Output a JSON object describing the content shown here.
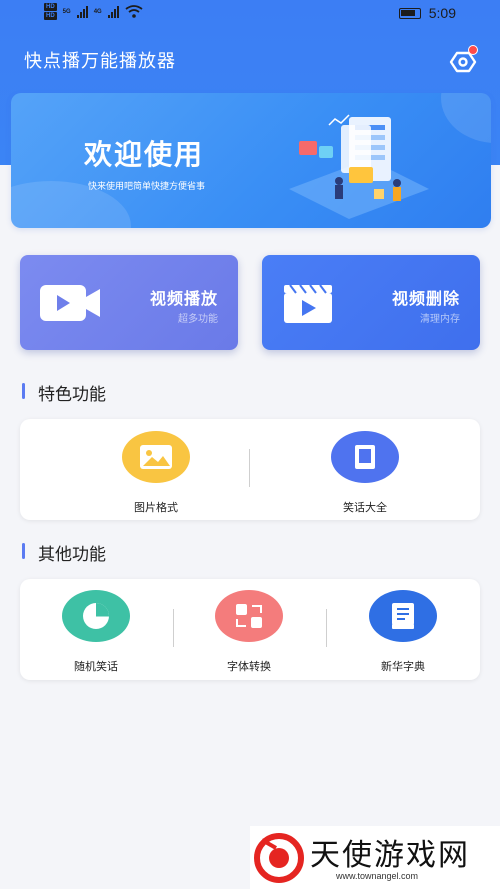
{
  "status_bar": {
    "hd1": "HD",
    "hd2": "HD",
    "net1": "5G",
    "net2": "4G",
    "time": "5:09"
  },
  "header": {
    "title": "快点播万能播放器"
  },
  "banner": {
    "title": "欢迎使用",
    "subtitle": "快来使用吧简单快捷方便省事"
  },
  "cards": [
    {
      "title": "视频播放",
      "subtitle": "超多功能"
    },
    {
      "title": "视频删除",
      "subtitle": "清理内存"
    }
  ],
  "featured": {
    "title": "特色功能",
    "items": [
      {
        "label": "图片格式",
        "color": "#f9c542"
      },
      {
        "label": "笑话大全",
        "color": "#4f73ef"
      }
    ]
  },
  "other": {
    "title": "其他功能",
    "items": [
      {
        "label": "随机笑话",
        "color": "#3ec1a5"
      },
      {
        "label": "字体转换",
        "color": "#f47c7c"
      },
      {
        "label": "新华字典",
        "color": "#2f6fe4"
      }
    ]
  },
  "watermark": {
    "text": "天使游戏网",
    "url": "www.townangel.com"
  }
}
